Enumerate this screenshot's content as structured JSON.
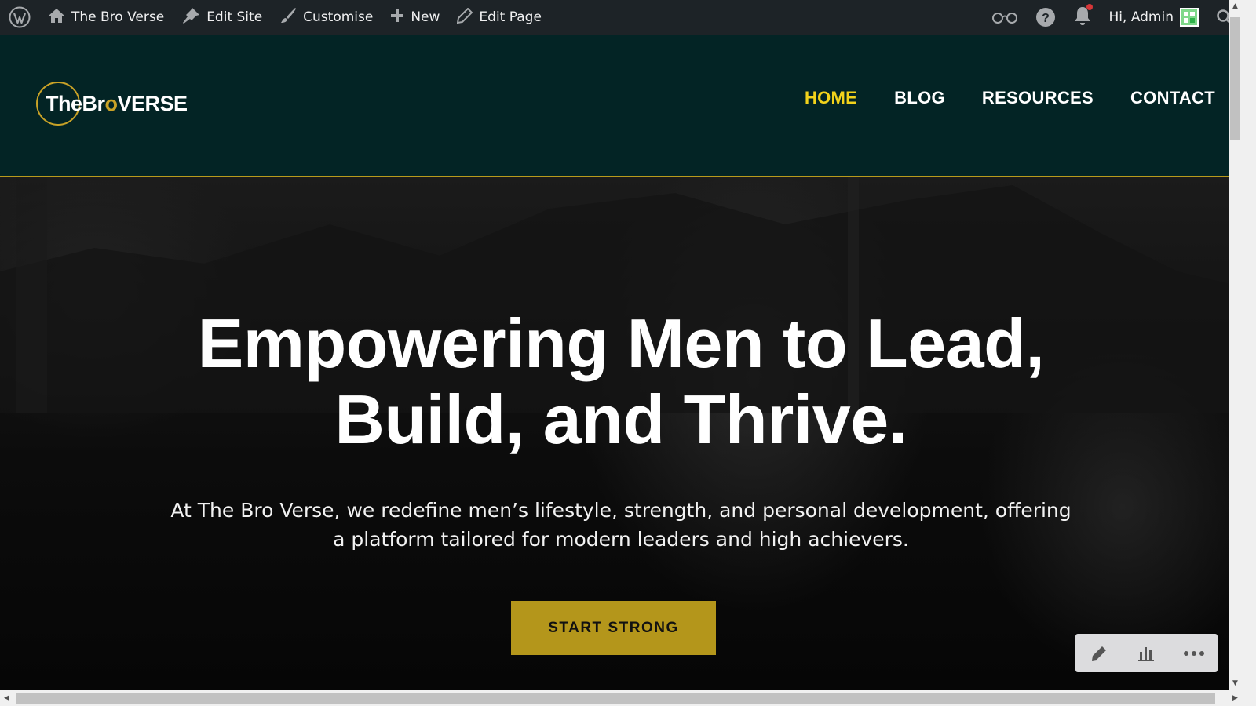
{
  "admin_bar": {
    "site_name": "The Bro Verse",
    "edit_site": "Edit Site",
    "customise": "Customise",
    "new": "New",
    "edit_page": "Edit Page",
    "greeting": "Hi, Admin"
  },
  "header": {
    "logo_text_a": "TheBr",
    "logo_text_o": "o",
    "logo_text_b": "VERSE",
    "nav": [
      "HOME",
      "BLOG",
      "RESOURCES",
      "CONTACT"
    ],
    "active_nav": "HOME"
  },
  "hero": {
    "heading_line1": "Empowering Men to Lead,",
    "heading_line2": "Build, and Thrive.",
    "intro_line1": "At The Bro Verse, we redefine men’s lifestyle, strength, and personal development, offering",
    "intro_line2": "a platform tailored for modern leaders and high achievers.",
    "cta": "START STRONG"
  },
  "colors": {
    "admin_bar_bg": "#1d2327",
    "header_bg": "#032425",
    "accent_gold": "#b4961b",
    "nav_active": "#f2d21b"
  },
  "icons": [
    "wordpress-logo-icon",
    "home-icon",
    "brush-pin-icon",
    "paintbrush-icon",
    "plus-icon",
    "pencil-icon",
    "reader-glasses-icon",
    "help-icon",
    "bell-icon",
    "search-icon",
    "bar-chart-icon",
    "more-dots-icon"
  ]
}
